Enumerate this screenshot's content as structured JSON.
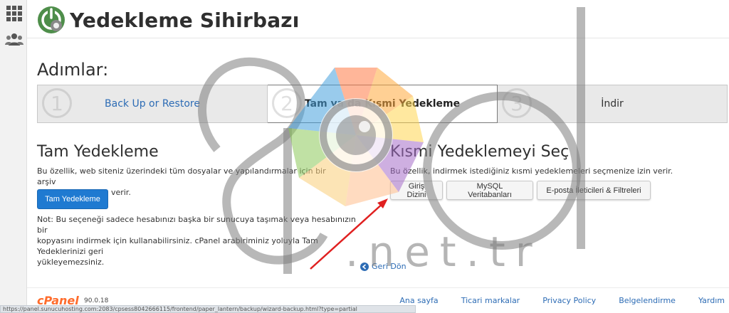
{
  "header": {
    "title": "Yedekleme Sihirbazı"
  },
  "steps": {
    "heading": "Adımlar:",
    "items": [
      {
        "number": "1",
        "label": "Back Up or Restore"
      },
      {
        "number": "2",
        "label": "Tam ya da Kısmi Yedekleme"
      },
      {
        "number": "3",
        "label": "İndir"
      }
    ]
  },
  "full_backup": {
    "title": "Tam Yedekleme",
    "description_line1": "Bu özellik, web siteniz üzerindeki tüm dosyalar ve yapılandırmalar için bir arşiv",
    "description_line2": "oluşturmanıza izin verir.",
    "button_label": "Tam Yedekleme",
    "note_line1": "Not: Bu seçeneği sadece hesabınızı başka bir sunucuya taşımak veya hesabınızın bir",
    "note_line2": "kopyasını indirmek için kullanabilirsiniz. cPanel arabiriminiz yoluyla Tam Yedeklerinizi geri",
    "note_line3": "yükleyemezsiniz."
  },
  "partial_backup": {
    "title": "Kısmi Yedeklemeyi Seç",
    "description": "Bu özellik, indirmek istediğiniz kısmi yedeklemeleri seçmenize izin verir.",
    "buttons": [
      {
        "label": "Giriş Dizini"
      },
      {
        "label": "MySQL Veritabanları"
      },
      {
        "label": "E-posta İleticileri & Filtreleri"
      }
    ]
  },
  "back_link": "Geri Dön",
  "footer": {
    "logo": "cPanel",
    "version": "90.0.18",
    "links": [
      "Ana sayfa",
      "Ticari markalar",
      "Privacy Policy",
      "Belgelendirme",
      "Yardım"
    ]
  },
  "status_bar": {
    "url": "https://panel.sunucuhosting.com:2083/cpsess8042666115/frontend/paper_lantern/backup/wizard-backup.html?type=partial"
  },
  "watermark": {
    "text_large": "spd",
    "text_small": ".net.tr"
  },
  "colors": {
    "accent": "#1f7ad1",
    "link": "#2d6cb5",
    "cpanel_orange": "#ff6c2c",
    "arrow": "#e02020"
  },
  "icons": {
    "rail_top": "grid-icon",
    "rail_second": "users-icon",
    "app_logo": "backup-wizard-icon",
    "back": "arrow-left-circle-icon"
  }
}
